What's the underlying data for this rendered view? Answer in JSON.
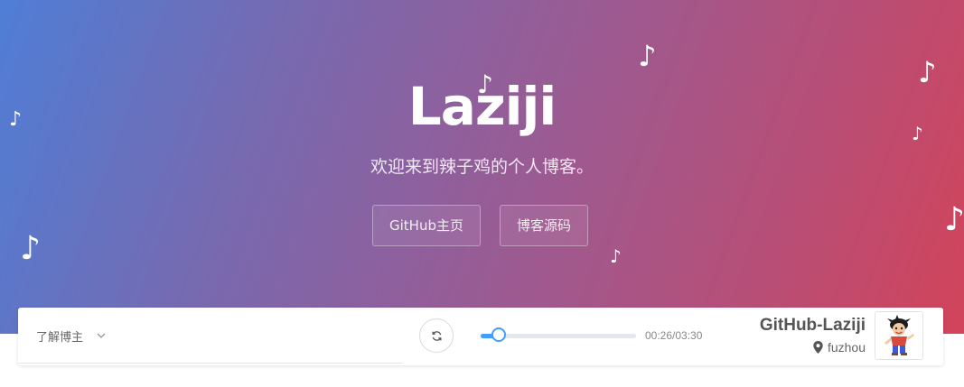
{
  "hero": {
    "title": "Laziji",
    "subtitle": "欢迎来到辣子鸡的个人博客。",
    "buttons": [
      {
        "label": "GitHub主页"
      },
      {
        "label": "博客源码"
      }
    ],
    "note_glyph": "♪"
  },
  "bar": {
    "menu_label": "了解博主",
    "player": {
      "progress_fraction": 0.124,
      "time": "00:26/03:30"
    },
    "profile": {
      "name": "GitHub-Laziji",
      "location": "fuzhou"
    }
  },
  "colors": {
    "gradient_start": "#4f7ed6",
    "gradient_end": "#d2445a",
    "accent": "#409eff"
  },
  "icons": [
    "chevron-down-icon",
    "refresh-icon",
    "location-pin-icon",
    "avatar"
  ]
}
